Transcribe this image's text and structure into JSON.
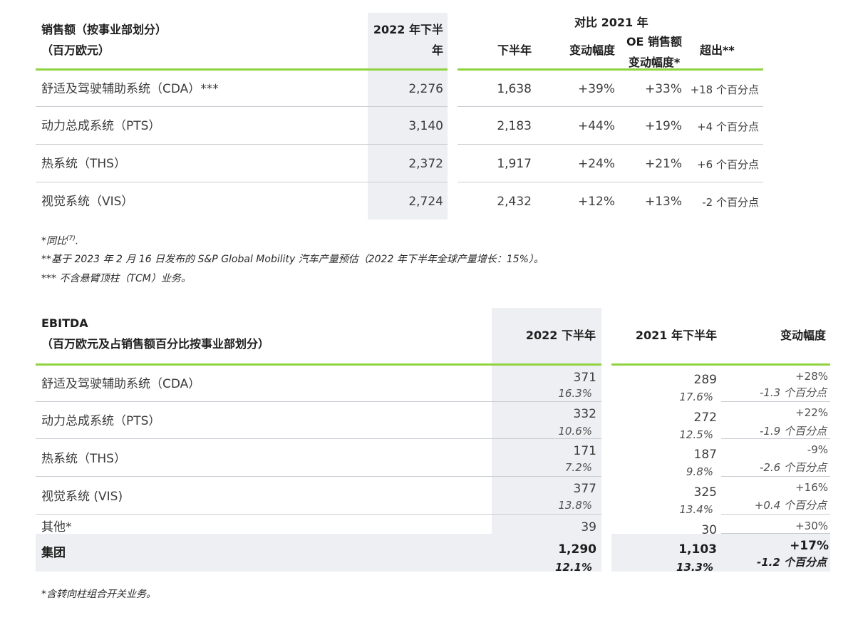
{
  "table1": {
    "header": {
      "col0_line1": "销售额（按事业部划分）",
      "col0_line2": "（百万欧元）",
      "col1_line1": "2022 年下半",
      "col1_line2": "年",
      "group_label": "对比 2021 年",
      "col2": "下半年",
      "col3": "变动幅度",
      "col4_line1": "OE 销售额",
      "col4_line2": "变动幅度*",
      "col5": "超出**"
    },
    "rows": [
      {
        "name": "舒适及驾驶辅助系统（CDA）***",
        "h2_2022": "2,276",
        "h2_2021": "1,638",
        "change": "+39%",
        "oe_change": "+33%",
        "outperf": "+18  个百分点"
      },
      {
        "name": "动力总成系统（PTS）",
        "h2_2022": "3,140",
        "h2_2021": "2,183",
        "change": "+44%",
        "oe_change": "+19%",
        "outperf": "+4  个百分点"
      },
      {
        "name": "热系统（THS）",
        "h2_2022": "2,372",
        "h2_2021": "1,917",
        "change": "+24%",
        "oe_change": "+21%",
        "outperf": "+6  个百分点"
      },
      {
        "name": "视觉系统（VIS）",
        "h2_2022": "2,724",
        "h2_2021": "2,432",
        "change": "+12%",
        "oe_change": "+13%",
        "outperf": "-2  个百分点"
      }
    ],
    "notes": {
      "n1_prefix": "*同比",
      "n1_sup": "(7)",
      "n1_suffix": ".",
      "n2": "**基于  2023  年  2  月  16  日发布的  S&P Global Mobility  汽车产量预估（2022  年下半年全球产量增长：15%）。",
      "n3": "*** 不含悬臂顶柱（TCM）业务。"
    }
  },
  "table2": {
    "header": {
      "title_line1": "EBITDA",
      "title_line2": "（百万欧元及占销售额百分比按事业部划分）",
      "col1": "2022  下半年",
      "col2": "2021  年下半年",
      "col3": "变动幅度"
    },
    "rows": [
      {
        "name": "舒适及驾驶辅助系统（CDA）",
        "v2022": "371",
        "p2022": "16.3%",
        "v2021": "289",
        "p2021": "17.6%",
        "change": "+28%",
        "pt_change": "-1.3  个百分点"
      },
      {
        "name": "动力总成系统（PTS）",
        "v2022": "332",
        "p2022": "10.6%",
        "v2021": "272",
        "p2021": "12.5%",
        "change": "+22%",
        "pt_change": "-1.9  个百分点"
      },
      {
        "name": "热系统（THS）",
        "v2022": "171",
        "p2022": "7.2%",
        "v2021": "187",
        "p2021": "9.8%",
        "change": "-9%",
        "pt_change": "-2.6  个百分点"
      },
      {
        "name": "视觉系统 (VIS)",
        "v2022": "377",
        "p2022": "13.8%",
        "v2021": "325",
        "p2021": "13.4%",
        "change": "+16%",
        "pt_change": "+0.4  个百分点"
      },
      {
        "name": "其他*",
        "v2022": "39",
        "v2021": "30",
        "change": "+30%"
      }
    ],
    "total": {
      "name": "集团",
      "v2022": "1,290",
      "p2022": "12.1%",
      "v2021": "1,103",
      "p2021": "13.3%",
      "change": "+17%",
      "pt_change": "-1.2  个百分点"
    },
    "note": "*含转向柱组合开关业务。"
  }
}
